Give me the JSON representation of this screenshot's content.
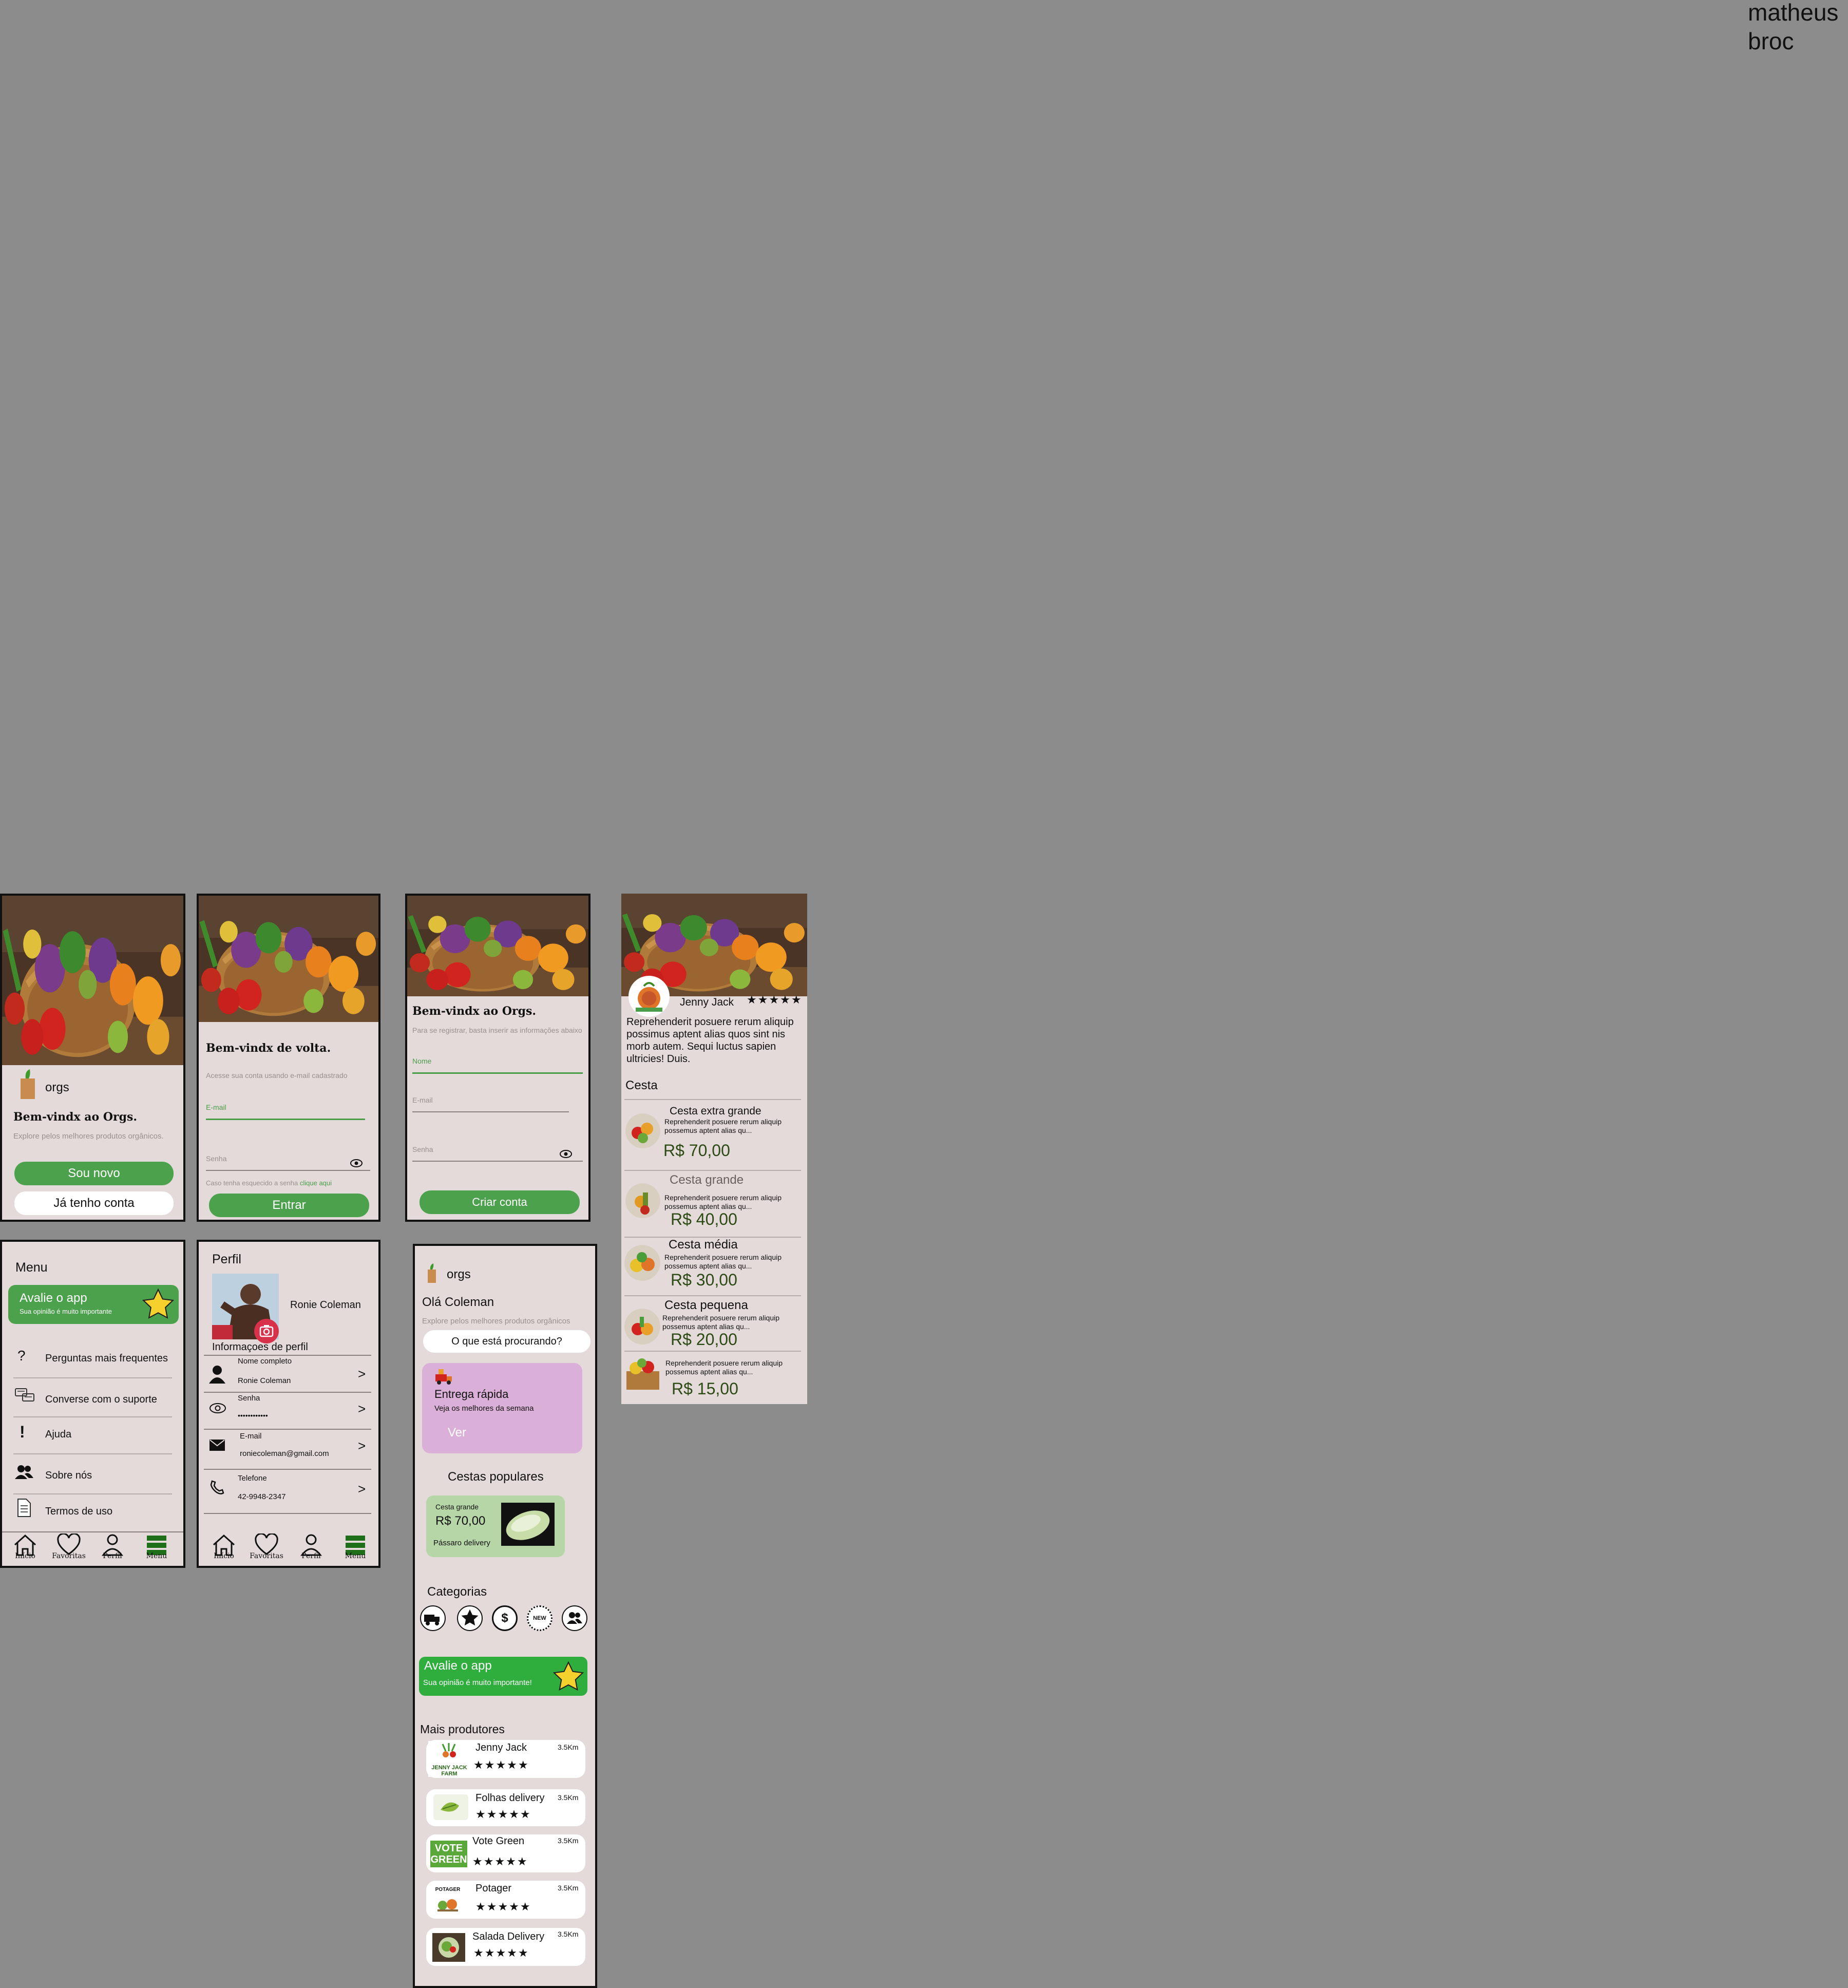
{
  "author": {
    "line1": "matheus",
    "line2": "broc"
  },
  "welcome": {
    "logo_text": "orgs",
    "title": "Bem-vindx ao Orgs.",
    "subtitle": "Explore pelos melhores produtos orgânicos.",
    "new_button": "Sou novo",
    "existing_button": "Já tenho conta"
  },
  "login": {
    "title": "Bem-vindx de volta.",
    "subtitle": "Acesse sua conta usando e-mail cadastrado",
    "email_label": "E-mail",
    "password_label": "Senha",
    "forgot_text": "Caso tenha esquecido a senha",
    "forgot_link": "clique aqui",
    "submit": "Entrar"
  },
  "register": {
    "title": "Bem-vindx ao Orgs.",
    "subtitle": "Para se registrar, basta inserir as informações abaixo",
    "name_label": "Nome",
    "email_label": "E-mail",
    "password_label": "Senha",
    "submit": "Criar conta"
  },
  "producer": {
    "name": "Jenny Jack",
    "stars": "★★★★★",
    "description": "Reprehenderit posuere rerum aliquip possimus aptent alias quos sint nis morb autem. Sequi luctus sapien ultricies! Duis.",
    "section": "Cesta",
    "items": [
      {
        "name": "Cesta extra grande",
        "desc": "Reprehenderit posuere rerum aliquip possemus aptent alias qu...",
        "price": "R$ 70,00"
      },
      {
        "name": "Cesta grande",
        "desc": "Reprehenderit posuere rerum aliquip possemus aptent alias qu...",
        "price": "R$ 40,00"
      },
      {
        "name": "Cesta média",
        "desc": "Reprehenderit posuere rerum aliquip possemus aptent alias qu...",
        "price": "R$ 30,00"
      },
      {
        "name": "Cesta pequena",
        "desc": "Reprehenderit posuere rerum aliquip possemus aptent alias qu...",
        "price": "R$ 20,00"
      },
      {
        "name": "",
        "desc": "Reprehenderit posuere rerum aliquip possemus aptent alias qu...",
        "price": "R$ 15,00"
      }
    ]
  },
  "menu": {
    "title": "Menu",
    "rate_title": "Avalie o app",
    "rate_sub": "Sua opinião é muito importante",
    "items": [
      "Perguntas mais frequentes",
      "Converse com o suporte",
      "Ajuda",
      "Sobre nós",
      "Termos de uso"
    ]
  },
  "profile": {
    "title": "Perfil",
    "user_name": "Ronie Coleman",
    "section": "Informaçoes de perfil",
    "fields": [
      {
        "label": "Nome completo",
        "value": "Ronie Coleman",
        "arrow": ">"
      },
      {
        "label": "Senha",
        "value": "••••••••••••",
        "arrow": ">"
      },
      {
        "label": "E-mail",
        "value": "roniecoleman@gmail.com",
        "arrow": ">"
      },
      {
        "label": "Telefone",
        "value": "42-9948-2347",
        "arrow": ">"
      }
    ]
  },
  "tabbar": {
    "home": "Início",
    "favorites": "Favoritas",
    "profile": "Perfil",
    "menu": "Menu"
  },
  "home": {
    "logo_text": "orgs",
    "greeting": "Olá Coleman",
    "subtitle": "Explore pelos melhores produtos orgânicos",
    "search_placeholder": "O que está procurando?",
    "promo_title": "Entrega rápida",
    "promo_sub": "Veja  os melhores da semana",
    "promo_button": "Ver",
    "popular_title": "Cestas populares",
    "popular_card": {
      "label": "Cesta grande",
      "price": "R$ 70,00",
      "seller": "Pássaro delivery"
    },
    "categories_title": "Categorias",
    "category_new": "NEW",
    "rate_title": "Avalie o app",
    "rate_sub": "Sua opinião é muito importante!",
    "producers_title": "Mais produtores",
    "producers": [
      {
        "name": "Jenny Jack",
        "distance": "3.5Km",
        "stars": "★★★★★"
      },
      {
        "name": "Folhas delivery",
        "distance": "3.5Km",
        "stars": "★★★★★"
      },
      {
        "name": "Vote Green",
        "distance": "3.5Km",
        "stars": "★★★★★"
      },
      {
        "name": "Potager",
        "distance": "3.5Km",
        "stars": "★★★★★"
      },
      {
        "name": "Salada Delivery",
        "distance": "3.5Km",
        "stars": "★★★★★"
      }
    ],
    "logo_jenny": "JENNY JACK FARM",
    "logo_vote": "VOTE GREEN",
    "logo_potager": "POTAGER"
  },
  "colors": {
    "background": "#8c8c8c",
    "screen": "#e5dada",
    "green": "#4ca24c",
    "promo": "#dbb0d8",
    "price_green": "#2c4a14"
  }
}
